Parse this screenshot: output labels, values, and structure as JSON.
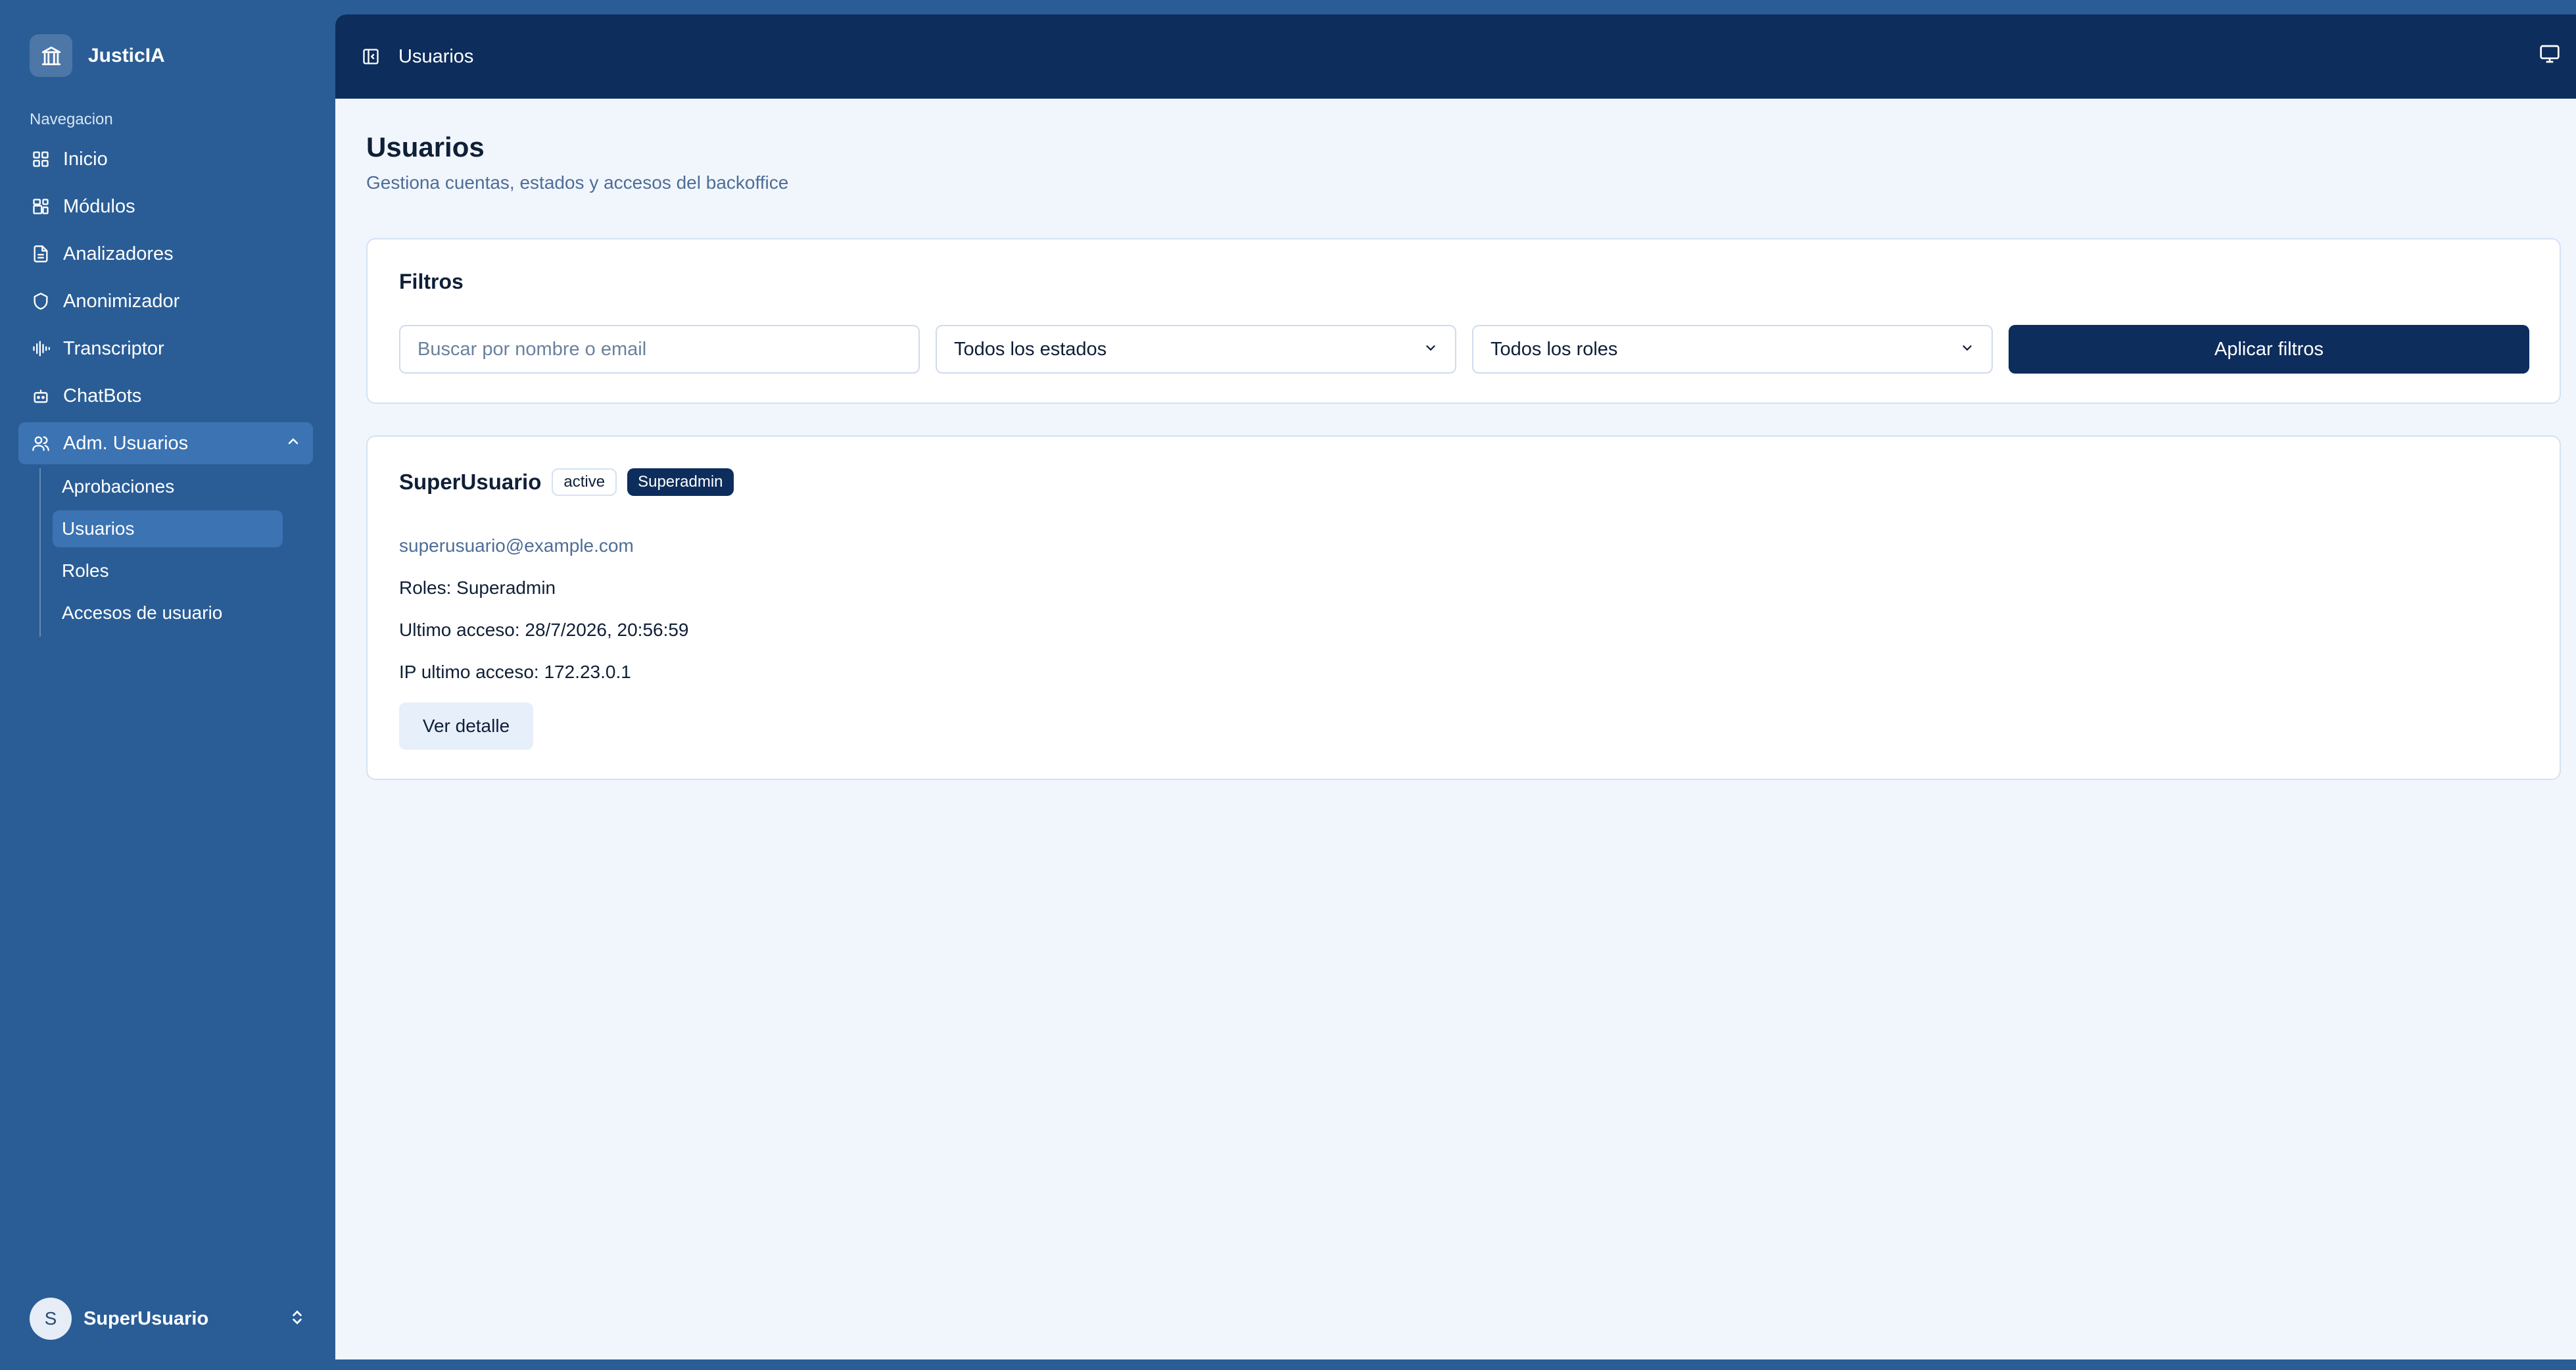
{
  "app": {
    "name": "JusticIA"
  },
  "sidebar": {
    "section_label": "Navegacion",
    "items": [
      {
        "label": "Inicio",
        "icon": "grid-icon"
      },
      {
        "label": "Módulos",
        "icon": "modules-icon"
      },
      {
        "label": "Analizadores",
        "icon": "document-icon"
      },
      {
        "label": "Anonimizador",
        "icon": "shield-icon"
      },
      {
        "label": "Transcriptor",
        "icon": "waveform-icon"
      },
      {
        "label": "ChatBots",
        "icon": "bot-icon"
      },
      {
        "label": "Adm. Usuarios",
        "icon": "users-icon",
        "expanded": true
      }
    ],
    "subitems": [
      {
        "label": "Aprobaciones"
      },
      {
        "label": "Usuarios",
        "active": true
      },
      {
        "label": "Roles"
      },
      {
        "label": "Accesos de usuario"
      }
    ],
    "user": {
      "initial": "S",
      "name": "SuperUsuario"
    }
  },
  "topbar": {
    "title": "Usuarios"
  },
  "page": {
    "title": "Usuarios",
    "subtitle": "Gestiona cuentas, estados y accesos del backoffice"
  },
  "filters": {
    "title": "Filtros",
    "search_placeholder": "Buscar por nombre o email",
    "status_selected": "Todos los estados",
    "role_selected": "Todos los roles",
    "apply_label": "Aplicar filtros"
  },
  "user_card": {
    "name": "SuperUsuario",
    "status_badge": "active",
    "role_badge": "Superadmin",
    "email": "superusuario@example.com",
    "roles_line": "Roles: Superadmin",
    "last_access_line": "Ultimo acceso: 28/7/2026, 20:56:59",
    "ip_line": "IP ultimo acceso: 172.23.0.1",
    "detail_label": "Ver detalle"
  },
  "colors": {
    "sidebar_bg": "#2a5d96",
    "topbar_bg": "#0d2d5c",
    "content_bg": "#f1f6fd",
    "active_item": "#3b73b3",
    "primary_button": "#0d2d5c"
  }
}
